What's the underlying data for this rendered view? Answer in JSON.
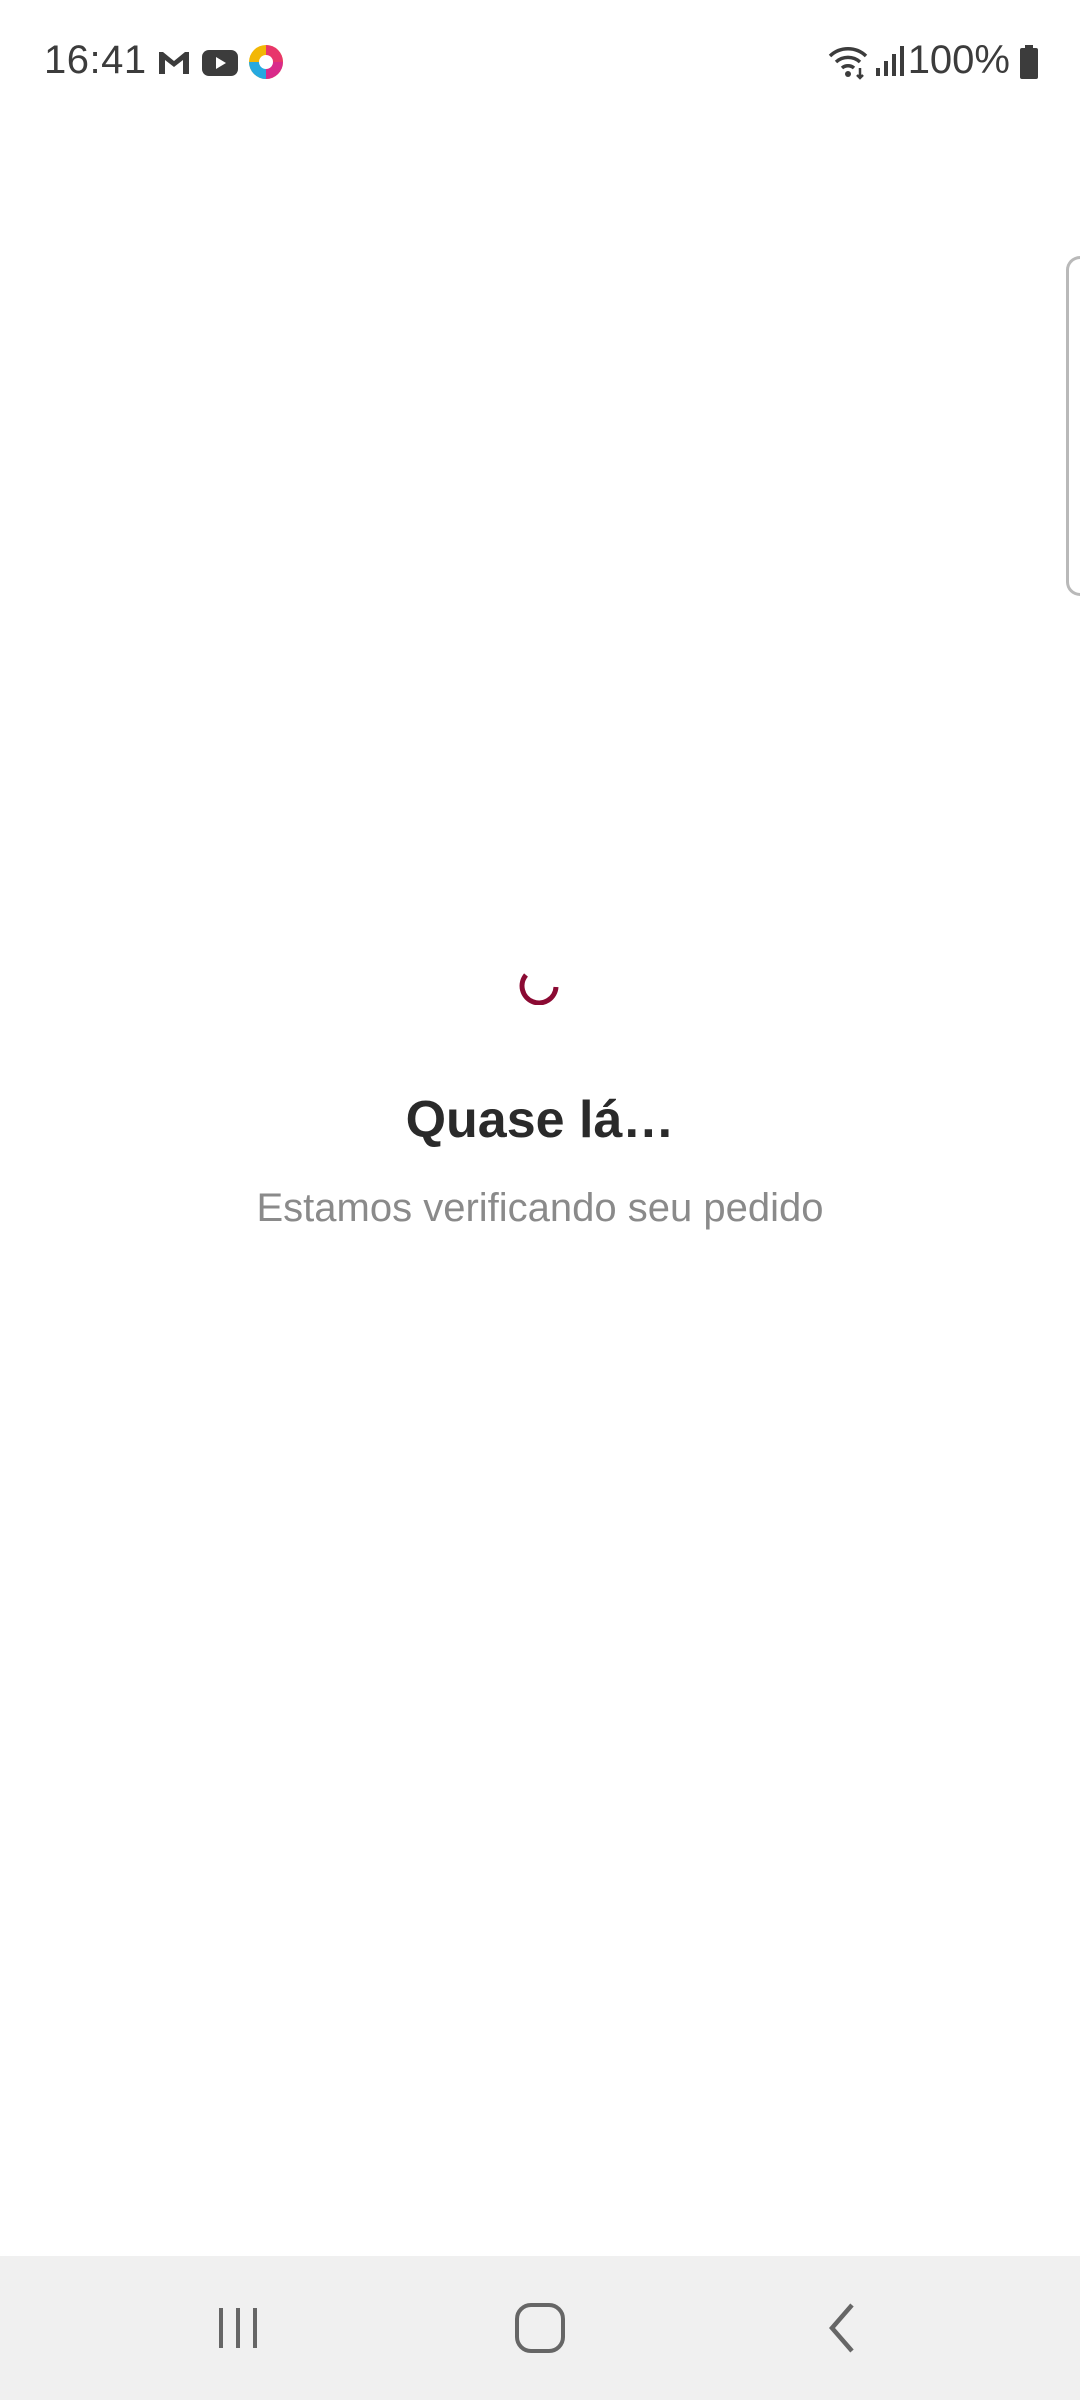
{
  "status_bar": {
    "time": "16:41",
    "notification_icons": [
      "gmail-icon",
      "youtube-icon",
      "app-circle-icon"
    ],
    "system_icons": [
      "wifi-icon",
      "signal-icon",
      "battery-icon"
    ],
    "battery_percent": "100%",
    "battery_level": 1.0
  },
  "loading": {
    "title": "Quase lá…",
    "subtitle": "Estamos verificando seu pedido",
    "spinner_color": "#8b0a33"
  },
  "nav_bar": {
    "buttons": [
      "recent-apps-icon",
      "home-icon",
      "back-icon"
    ]
  }
}
